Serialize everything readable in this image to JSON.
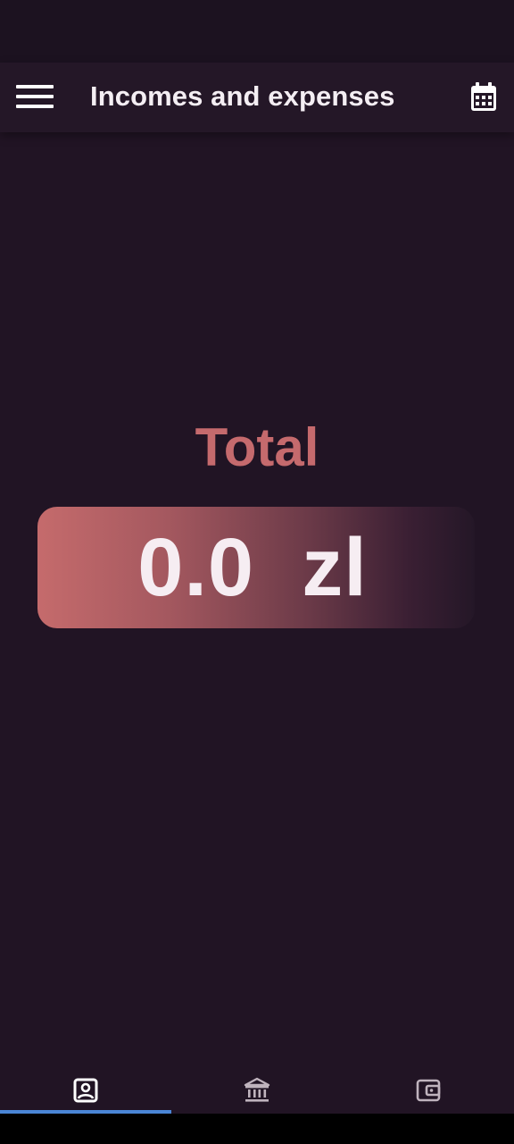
{
  "app_bar": {
    "title": "Incomes and expenses",
    "menu_icon": "hamburger-menu-icon",
    "calendar_icon": "calendar-icon"
  },
  "summary": {
    "label": "Total",
    "value": "0.0  zl"
  },
  "bottom_nav": {
    "items": [
      {
        "icon": "portrait-icon",
        "selected": true
      },
      {
        "icon": "bank-icon",
        "selected": false
      },
      {
        "icon": "wallet-icon",
        "selected": false
      }
    ]
  },
  "colors": {
    "background": "#211424",
    "accent": "#c56a6d",
    "indicator": "#4a86d6",
    "text_light": "#f4eef3"
  }
}
